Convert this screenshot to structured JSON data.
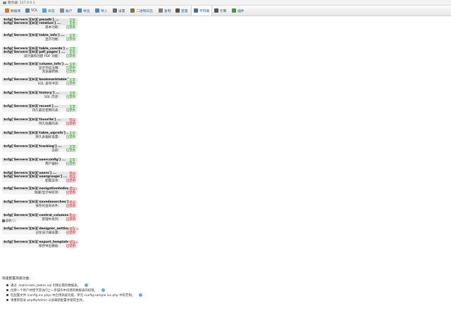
{
  "breadcrumb": {
    "text": "服务器: 127.0.0.1"
  },
  "tabs": [
    {
      "label": "数据库",
      "icon": "database-icon",
      "color": "#c97a2b"
    },
    {
      "label": "SQL",
      "icon": "sql-icon",
      "color": "#5c7dbb"
    },
    {
      "label": "状态",
      "icon": "status-icon",
      "color": "#4aa3df"
    },
    {
      "label": "账户",
      "icon": "users-icon",
      "color": "#7d8a99"
    },
    {
      "label": "导出",
      "icon": "export-icon",
      "color": "#4c86c6"
    },
    {
      "label": "导入",
      "icon": "import-icon",
      "color": "#4c86c6"
    },
    {
      "label": "设置",
      "icon": "settings-icon",
      "color": "#6a6a6a"
    },
    {
      "label": "二进制日志",
      "icon": "binlog-icon",
      "color": "#8a6f3d"
    },
    {
      "label": "复制",
      "icon": "replication-icon",
      "color": "#7a7a7a"
    },
    {
      "label": "变量",
      "icon": "variables-icon",
      "color": "#555555"
    },
    {
      "label": "字符集",
      "icon": "charset-icon",
      "color": "#3d6fb0"
    },
    {
      "label": "引擎",
      "icon": "engines-icon",
      "color": "#555555"
    },
    {
      "label": "插件",
      "icon": "plugins-icon",
      "color": "#3f9b3f"
    }
  ],
  "groups": [
    {
      "rows": [
        {
          "label": "$cfg['Servers'][$i]['pmadb'] ...",
          "status": "正常",
          "kind": "ok"
        },
        {
          "label": "$cfg['Servers'][$i]['relation'] ...",
          "status": "正常",
          "kind": "ok"
        },
        {
          "label": "基本功能:",
          "status": "已禁用",
          "kind": "dis",
          "feat": true
        }
      ]
    },
    {
      "rows": [
        {
          "label": "$cfg['Servers'][$i]['table_info'] ...",
          "status": "正常",
          "kind": "ok"
        },
        {
          "label": "显示功能:",
          "status": "已禁用",
          "kind": "dis",
          "feat": true
        }
      ]
    },
    {
      "rows": [
        {
          "label": "$cfg['Servers'][$i]['table_coords'] ...",
          "status": "正常",
          "kind": "ok"
        },
        {
          "label": "$cfg['Servers'][$i]['pdf_pages'] ...",
          "status": "正常",
          "kind": "ok"
        },
        {
          "label": "设计器和创建 PDF 功能:",
          "status": "已禁用",
          "kind": "dis",
          "feat": true
        }
      ]
    },
    {
      "rows": [
        {
          "label": "$cfg['Servers'][$i]['column_info'] ...",
          "status": "正常",
          "kind": "ok"
        },
        {
          "label": "显示字段注释:",
          "status": "已禁用",
          "kind": "dis",
          "feat": true
        },
        {
          "label": "浏览器转换:",
          "status": "已禁用",
          "kind": "dis",
          "feat": true
        }
      ]
    },
    {
      "rows": [
        {
          "label": "$cfg['Servers'][$i]['bookmarktable'] ...",
          "status": "正常",
          "kind": "ok"
        },
        {
          "label": "SQL 查询书签:",
          "status": "已禁用",
          "kind": "dis",
          "feat": true
        }
      ]
    },
    {
      "rows": [
        {
          "label": "$cfg['Servers'][$i]['history'] ...",
          "status": "正常",
          "kind": "ok"
        },
        {
          "label": "SQL 历史:",
          "status": "已禁用",
          "kind": "dis",
          "feat": true
        }
      ]
    },
    {
      "rows": [
        {
          "label": "$cfg['Servers'][$i]['recent'] ...",
          "status": "正常",
          "kind": "ok"
        },
        {
          "label": "持久最近使用的表:",
          "status": "已禁用",
          "kind": "dis",
          "feat": true
        }
      ]
    },
    {
      "rows": [
        {
          "label": "$cfg['Servers'][$i]['favorite'] ...",
          "status": "错误",
          "kind": "bad"
        },
        {
          "label": "持久收藏的表:",
          "status": "已禁用",
          "kind": "bad",
          "feat": true
        }
      ]
    },
    {
      "rows": [
        {
          "label": "$cfg['Servers'][$i]['table_uiprefs'] ...",
          "status": "正常",
          "kind": "ok"
        },
        {
          "label": "持久表偏好设置:",
          "status": "已禁用",
          "kind": "dis",
          "feat": true
        }
      ]
    },
    {
      "rows": [
        {
          "label": "$cfg['Servers'][$i]['tracking'] ...",
          "status": "正常",
          "kind": "ok"
        },
        {
          "label": "追踪:",
          "status": "已禁用",
          "kind": "dis",
          "feat": true
        }
      ]
    },
    {
      "rows": [
        {
          "label": "$cfg['Servers'][$i]['userconfig'] ...",
          "status": "正常",
          "kind": "ok"
        },
        {
          "label": "用户偏好:",
          "status": "已禁用",
          "kind": "dis",
          "feat": true
        }
      ]
    },
    {
      "rows": [
        {
          "label": "$cfg['Servers'][$i]['users'] ...",
          "status": "错误",
          "kind": "bad"
        },
        {
          "label": "$cfg['Servers'][$i]['usergroups'] ...",
          "status": "错误",
          "kind": "bad"
        },
        {
          "label": "配置菜单:",
          "status": "已禁用",
          "kind": "bad",
          "feat": true
        }
      ]
    },
    {
      "rows": [
        {
          "label": "$cfg['Servers'][$i]['navigationhiding'] ...",
          "status": "错误",
          "kind": "bad"
        },
        {
          "label": "隐藏/显示导航项:",
          "status": "已禁用",
          "kind": "bad",
          "feat": true
        }
      ]
    },
    {
      "rows": [
        {
          "label": "$cfg['Servers'][$i]['savedsearches'] ...",
          "status": "错误",
          "kind": "bad"
        },
        {
          "label": "保存的查询条件:",
          "status": "已禁用",
          "kind": "bad",
          "feat": true
        }
      ]
    },
    {
      "rows": [
        {
          "label": "$cfg['Servers'][$i]['central_columns'] ...",
          "status": "错误",
          "kind": "bad"
        },
        {
          "label": "管理中央列:",
          "status": "已禁用",
          "kind": "bad",
          "feat": true
        }
      ]
    },
    {
      "rows": [
        {
          "label": "$cfg['Servers'][$i]['designer_settings'] ...",
          "status": "错误",
          "kind": "bad"
        },
        {
          "label": "记住设计器设置:",
          "status": "已禁用",
          "kind": "bad",
          "feat": true
        }
      ]
    },
    {
      "rows": [
        {
          "label": "$cfg['Servers'][$i]['export_templates'] ...",
          "status": "错误",
          "kind": "bad"
        },
        {
          "label": "保存导出模板:",
          "status": "已禁用",
          "kind": "bad",
          "feat": true
        }
      ]
    }
  ],
  "info_badge": {
    "label": "说明"
  },
  "quick_steps": {
    "title": "快速配置高级功能:",
    "items": [
      "通过 ./sql/create_tables.sql 创建必需的数据表。",
      "创建一个用户并授予其访问上一步操作中创建的数据表的权限。",
      "在配置文件 (config.inc.php) 中启用高级功能，参见 config.sample.inc.php 中的范例。",
      "请重新登录 phpMyAdmin 以加载新配置并使其生效。"
    ]
  }
}
